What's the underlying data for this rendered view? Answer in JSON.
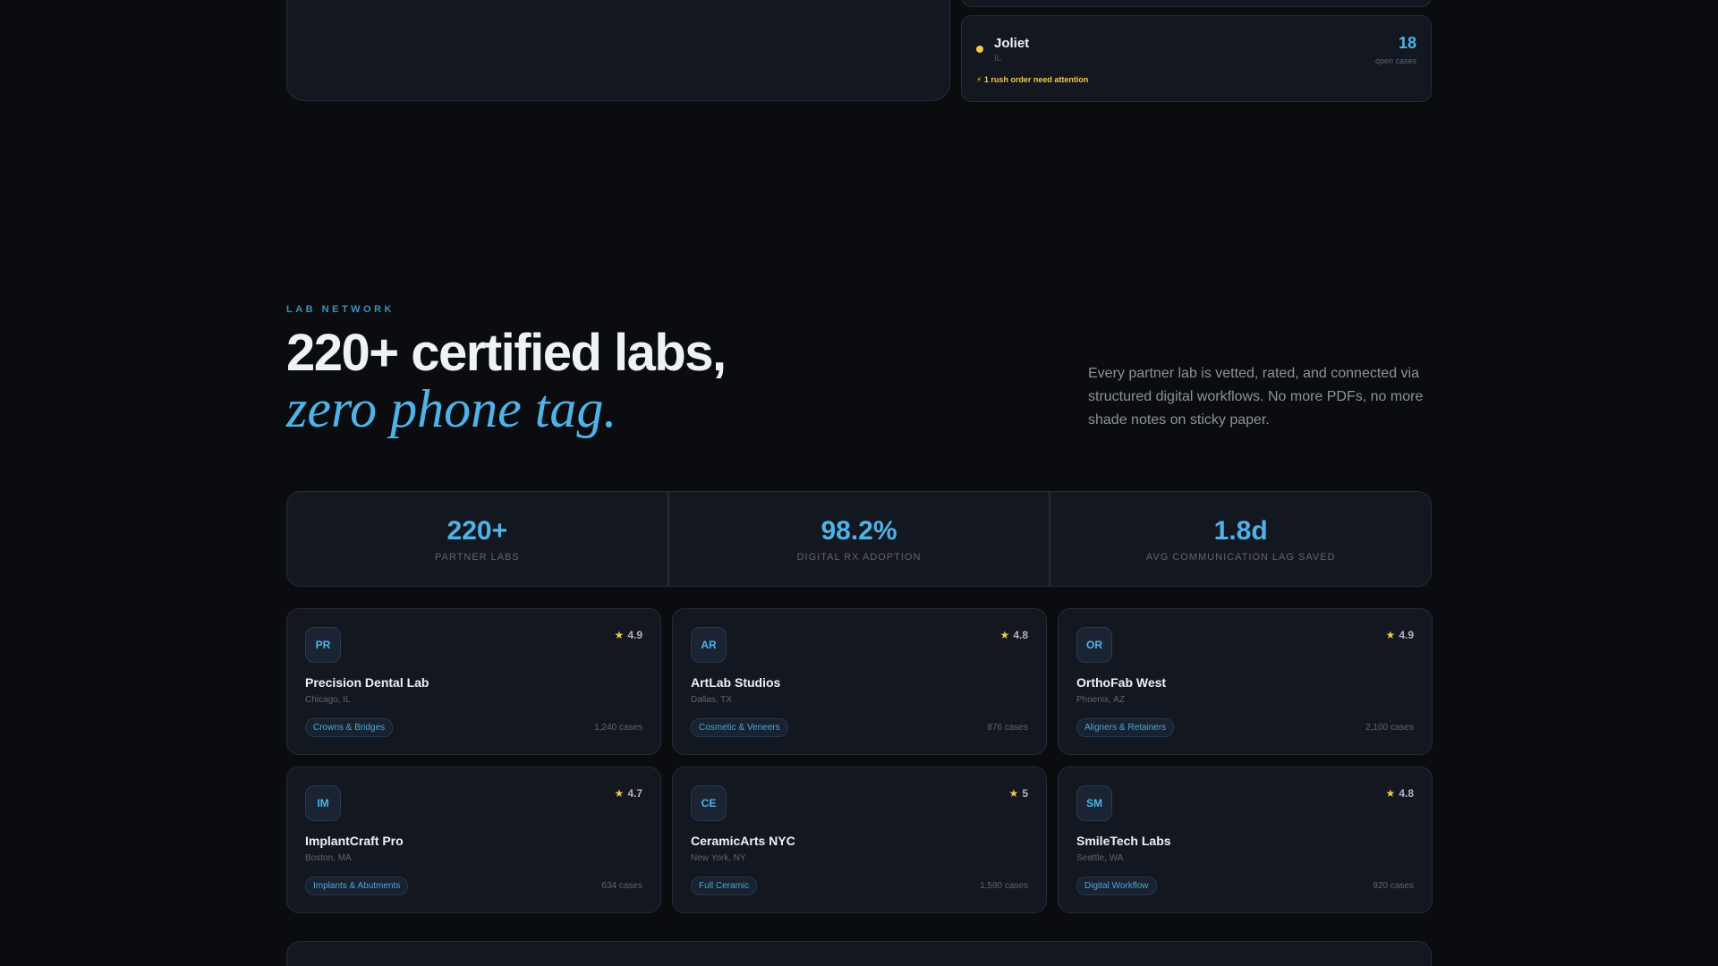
{
  "city_card": {
    "name": "Joliet",
    "state": "IL",
    "count": "18",
    "count_label": "open cases",
    "alert": "⚡ 1 rush order need attention"
  },
  "section": {
    "eyebrow": "LAB NETWORK",
    "headline": "220+ certified labs,",
    "headline_italic": "zero phone tag.",
    "intro": "Every partner lab is vetted, rated, and connected via structured digital workflows. No more PDFs, no more shade notes on sticky paper."
  },
  "stats": [
    {
      "value": "220+",
      "label": "PARTNER LABS"
    },
    {
      "value": "98.2%",
      "label": "DIGITAL RX ADOPTION"
    },
    {
      "value": "1.8d",
      "label": "AVG COMMUNICATION LAG SAVED"
    }
  ],
  "labs": [
    {
      "initials": "PR",
      "rating": "4.9",
      "name": "Precision Dental Lab",
      "location": "Chicago, IL",
      "tag": "Crowns & Bridges",
      "cases": "1,240 cases"
    },
    {
      "initials": "AR",
      "rating": "4.8",
      "name": "ArtLab Studios",
      "location": "Dallas, TX",
      "tag": "Cosmetic & Veneers",
      "cases": "876 cases"
    },
    {
      "initials": "OR",
      "rating": "4.9",
      "name": "OrthoFab West",
      "location": "Phoenix, AZ",
      "tag": "Aligners & Retainers",
      "cases": "2,100 cases"
    },
    {
      "initials": "IM",
      "rating": "4.7",
      "name": "ImplantCraft Pro",
      "location": "Boston, MA",
      "tag": "Implants & Abutments",
      "cases": "634 cases"
    },
    {
      "initials": "CE",
      "rating": "5",
      "name": "CeramicArts NYC",
      "location": "New York, NY",
      "tag": "Full Ceramic",
      "cases": "1,580 cases"
    },
    {
      "initials": "SM",
      "rating": "4.8",
      "name": "SmileTech Labs",
      "location": "Seattle, WA",
      "tag": "Digital Workflow",
      "cases": "920 cases"
    }
  ],
  "icons": {
    "star": "star-icon",
    "status_dot": "status-dot-icon"
  },
  "colors": {
    "accent": "#4fb3e8",
    "warning": "#f2c94c",
    "background": "#0b0c10",
    "card": "#131720"
  }
}
